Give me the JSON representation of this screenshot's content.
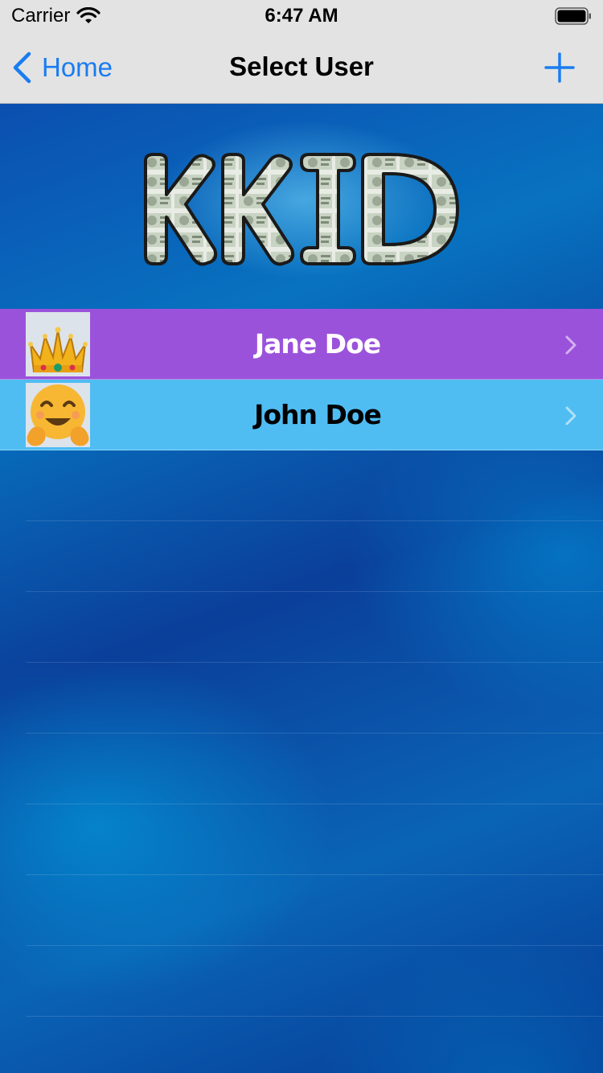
{
  "status_bar": {
    "carrier": "Carrier",
    "time": "6:47 AM"
  },
  "nav": {
    "back_label": "Home",
    "title": "Select User",
    "add_icon": "plus-icon"
  },
  "logo": {
    "text": "KKID"
  },
  "users": [
    {
      "name": "Jane Doe",
      "avatar": "crown-emoji",
      "row_color": "#9b52db",
      "text_color": "#ffffff"
    },
    {
      "name": "John Doe",
      "avatar": "hugging-face-emoji",
      "row_color": "#4fbdf2",
      "text_color": "#000000"
    }
  ],
  "colors": {
    "accent": "#1a7cf0",
    "nav_background": "#e3e3e3"
  }
}
